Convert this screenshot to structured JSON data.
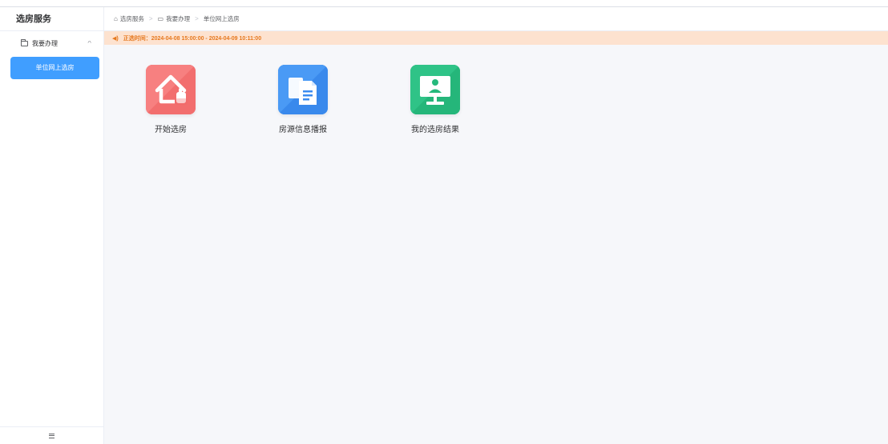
{
  "sidebar": {
    "title": "选房服务",
    "group": {
      "label": "我要办理",
      "expanded": true
    },
    "active_item": "单位网上选房"
  },
  "breadcrumb": [
    {
      "label": "选房服务",
      "icon": "home-icon"
    },
    {
      "label": "我要办理",
      "icon": "folder-icon"
    },
    {
      "label": "单位网上选房"
    }
  ],
  "notice": {
    "text": "正选时间：2024-04-08 15:00:00 - 2024-04-09 10:11:00",
    "icon": "speaker-icon"
  },
  "tiles": [
    {
      "label": "开始选房",
      "icon": "house-click-icon",
      "color": "#f26b6b"
    },
    {
      "label": "房源信息播报",
      "icon": "documents-icon",
      "color": "#3b8cf0"
    },
    {
      "label": "我的选房结果",
      "icon": "monitor-user-icon",
      "color": "#25b97c"
    }
  ],
  "colors": {
    "accent": "#409eff",
    "notice_bg": "#fde2cf",
    "notice_text": "#e6781e",
    "main_bg": "#f6f7fa"
  }
}
